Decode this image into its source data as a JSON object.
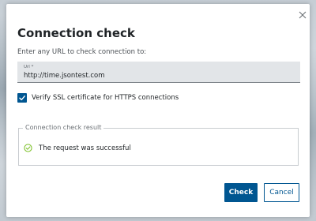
{
  "dialog": {
    "title": "Connection check",
    "close_icon": "close-icon",
    "instruction": "Enter any URL to check connection to:"
  },
  "url_field": {
    "label": "Url *",
    "value": "http://time.jsontest.com"
  },
  "ssl_checkbox": {
    "checked": true,
    "label": "Verify SSL certificate for HTTPS connections",
    "icon": "checkmark-icon"
  },
  "result": {
    "legend": "Connection check result",
    "icon": "success-circle-icon",
    "message": "The request was successful"
  },
  "buttons": {
    "check": "Check",
    "cancel": "Cancel"
  },
  "colors": {
    "accent": "#005691",
    "success": "#78be20",
    "field_bg": "#e2e5e8"
  }
}
